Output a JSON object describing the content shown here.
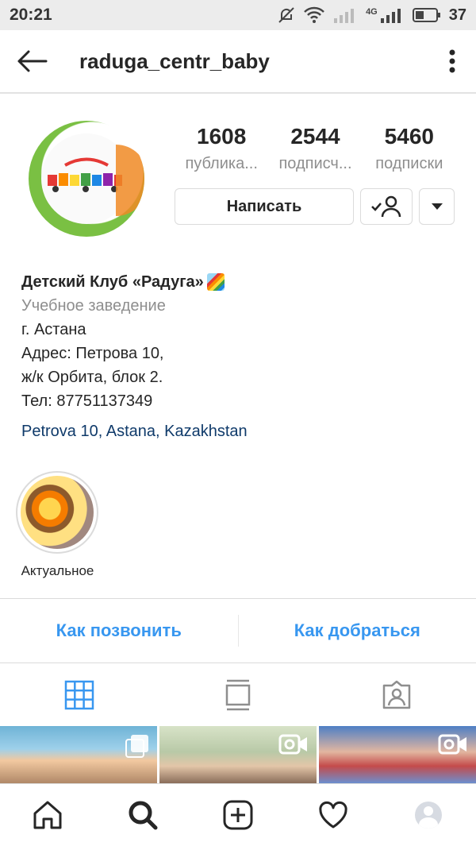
{
  "status_bar": {
    "time": "20:21",
    "network": "4G",
    "battery": "37"
  },
  "header": {
    "username": "raduga_centr_baby",
    "back_icon": "arrow-left-icon",
    "more_icon": "more-vertical-icon"
  },
  "profile": {
    "avatar_icon": "profile-avatar",
    "stats": [
      {
        "value": "1608",
        "label": "публика..."
      },
      {
        "value": "2544",
        "label": "подписч..."
      },
      {
        "value": "5460",
        "label": "подписки"
      }
    ],
    "message_button": "Написать",
    "following_icon": "user-check-icon",
    "dropdown_icon": "caret-down-icon"
  },
  "bio": {
    "name": "Детский Клуб «Радуга»",
    "name_emoji": "rainbow-icon",
    "category": "Учебное заведение",
    "lines": [
      "г. Астана",
      "Адрес: Петрова 10,",
      "ж/к Орбита, блок 2.",
      "Тел: 87751137349"
    ],
    "location": "Petrova 10, Astana, Kazakhstan"
  },
  "highlights": [
    {
      "label": "Актуальное"
    }
  ],
  "contact": {
    "call": "Как позвонить",
    "directions": "Как добраться"
  },
  "tabs": [
    "grid-icon",
    "feed-icon",
    "tagged-icon"
  ],
  "bottom_nav": [
    "home-icon",
    "search-icon",
    "add-icon",
    "heart-icon",
    "profile-icon"
  ],
  "colors": {
    "accent": "#3897f0",
    "location": "#0f3a6a",
    "muted": "#8e8e8e"
  }
}
